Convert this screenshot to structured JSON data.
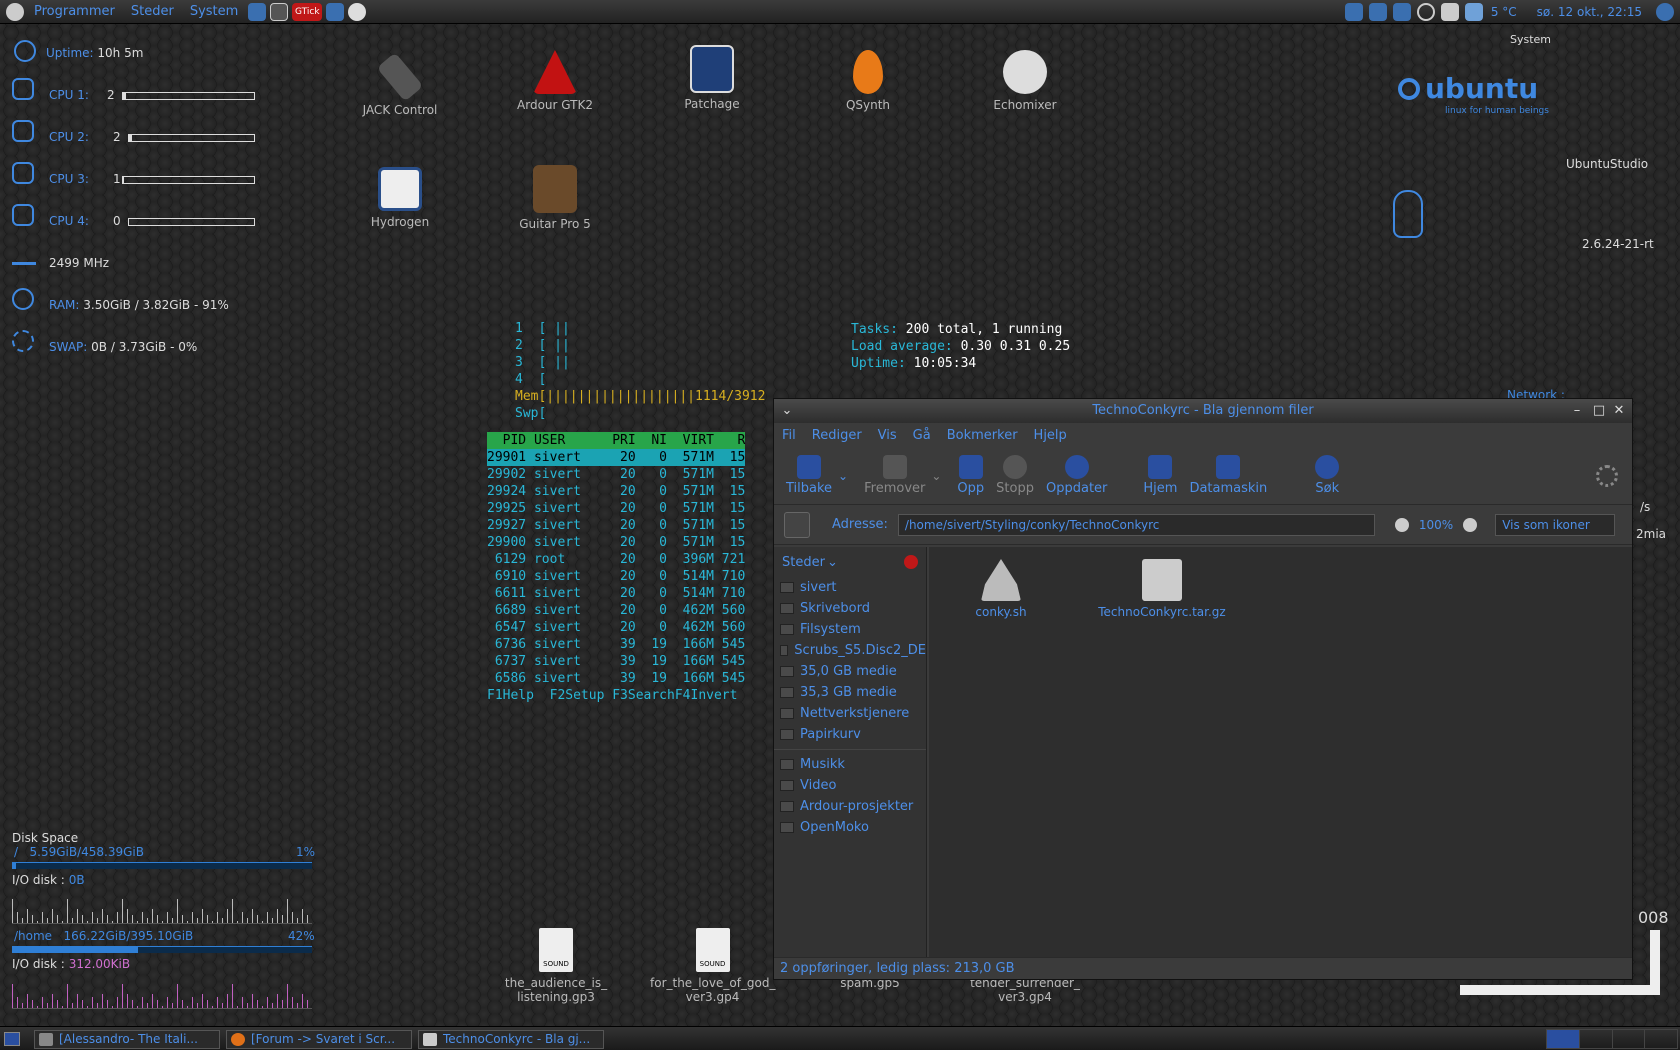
{
  "top_panel": {
    "menus": [
      "Programmer",
      "Steder",
      "System"
    ],
    "applet_label": "GTick",
    "weather": "5 °C",
    "clock": "sø. 12 okt., 22:15"
  },
  "conky_left": {
    "uptime_label": "Uptime:",
    "uptime": "10h 5m",
    "cpus": [
      {
        "label": "CPU 1:",
        "value": "2",
        "fill": 0.02
      },
      {
        "label": "CPU 2:",
        "value": "2",
        "fill": 0.02
      },
      {
        "label": "CPU 3:",
        "value": "1",
        "fill": 0.01
      },
      {
        "label": "CPU 4:",
        "value": "0",
        "fill": 0.0
      }
    ],
    "freq": "2499 MHz",
    "ram_label": "RAM:",
    "ram": "3.50GiB / 3.82GiB - 91%",
    "swap_label": "SWAP:",
    "swap": "0B / 3.73GiB - 0%"
  },
  "conky_disk": {
    "title": "Disk Space",
    "root_label": "/",
    "root_usage": "5.59GiB/458.39GiB",
    "root_pct": "1%",
    "root_fill": 0.012,
    "io_label1": "I/O disk :",
    "io1": "0B",
    "home_label": "/home",
    "home_usage": "166.22GiB/395.10GiB",
    "home_pct": "42%",
    "home_fill": 0.42,
    "io_label2": "I/O disk :",
    "io2": "312.00KiB"
  },
  "conky_right": {
    "system": "System",
    "distro": "UbuntuStudio",
    "kernel": "2.6.24-21-rt",
    "network": "Network :",
    "ubuntu_logo": "ubuntu",
    "ubuntu_tag": "linux for human beings",
    "partial_rate": "/s",
    "partial_mia": "2mia",
    "partial_year": "008"
  },
  "desktop_icons": [
    {
      "label": "JACK Control",
      "icon": "jack-icon"
    },
    {
      "label": "Ardour GTK2",
      "icon": "ardour-icon"
    },
    {
      "label": "Patchage",
      "icon": "patchage-icon"
    },
    {
      "label": "QSynth",
      "icon": "qsynth-icon"
    },
    {
      "label": "Echomixer",
      "icon": "echomixer-icon"
    },
    {
      "label": "Hydrogen",
      "icon": "hydrogen-icon"
    },
    {
      "label": "Guitar Pro 5",
      "icon": "guitarpro-icon"
    }
  ],
  "sound_files": [
    {
      "label": "the_audience_is_ listening.gp3",
      "badge": "SOUND"
    },
    {
      "label": "for_the_love_of_god_ ver3.gp4",
      "badge": "SOUND"
    },
    {
      "label": "spam.gp5"
    },
    {
      "label": "tender_surrender_ ver3.gp4"
    }
  ],
  "htop": {
    "cpu_rows": [
      "1  [ ||",
      "2  [ ||",
      "3  [ ||",
      "4  ["
    ],
    "mem": "Mem[|||||||||||||||||||1114/3912",
    "swp": "Swp[",
    "tasks_label": "Tasks:",
    "tasks": "200 total, 1 running",
    "load_label": "Load average:",
    "load": "0.30 0.31 0.25",
    "uptime_label": "Uptime:",
    "uptime": "10:05:34",
    "header": "  PID USER      PRI  NI  VIRT   R",
    "rows": [
      "29901 sivert     20   0  571M  15",
      "29902 sivert     20   0  571M  15",
      "29924 sivert     20   0  571M  15",
      "29925 sivert     20   0  571M  15",
      "29927 sivert     20   0  571M  15",
      "29900 sivert     20   0  571M  15",
      " 6129 root       20   0  396M 721",
      " 6910 sivert     20   0  514M 710",
      " 6611 sivert     20   0  514M 710",
      " 6689 sivert     20   0  462M 560",
      " 6547 sivert     20   0  462M 560",
      " 6736 sivert     39  19  166M 545",
      " 6737 sivert     39  19  166M 545",
      " 6586 sivert     39  19  166M 545"
    ],
    "footer": "F1Help  F2Setup F3SearchF4Invert"
  },
  "file_manager": {
    "title": "TechnoConkyrc - Bla gjennom filer",
    "menu": [
      "Fil",
      "Rediger",
      "Vis",
      "Gå",
      "Bokmerker",
      "Hjelp"
    ],
    "toolbar": [
      {
        "label": "Tilbake",
        "icon": "back-icon",
        "enabled": true
      },
      {
        "label": "Fremover",
        "icon": "forward-icon",
        "enabled": false
      },
      {
        "label": "Opp",
        "icon": "up-icon",
        "enabled": true
      },
      {
        "label": "Stopp",
        "icon": "stop-icon",
        "enabled": false
      },
      {
        "label": "Oppdater",
        "icon": "reload-icon",
        "enabled": true
      },
      {
        "label": "Hjem",
        "icon": "home-icon",
        "enabled": true
      },
      {
        "label": "Datamaskin",
        "icon": "computer-icon",
        "enabled": true
      },
      {
        "label": "Søk",
        "icon": "search-icon",
        "enabled": true
      }
    ],
    "address_label": "Adresse:",
    "address": "/home/sivert/Styling/conky/TechnoConkyrc",
    "zoom": "100%",
    "view_mode": "Vis som ikoner",
    "sidebar_title": "Steder",
    "places": [
      "sivert",
      "Skrivebord",
      "Filsystem",
      "Scrubs_S5.Disc2_DE",
      "35,0 GB medie",
      "35,3 GB medie",
      "Nettverkstjenere",
      "Papirkurv"
    ],
    "bookmarks": [
      "Musikk",
      "Video",
      "Ardour-prosjekter",
      "OpenMoko"
    ],
    "files": [
      "conky.sh",
      "TechnoConkyrc.tar.gz"
    ],
    "status": "2 oppføringer, ledig plass: 213,0 GB"
  },
  "taskbar": {
    "tasks": [
      "[Alessandro- The Itali...",
      "[Forum -> Svaret i Scr...",
      "TechnoConkyrc - Bla gj..."
    ]
  }
}
